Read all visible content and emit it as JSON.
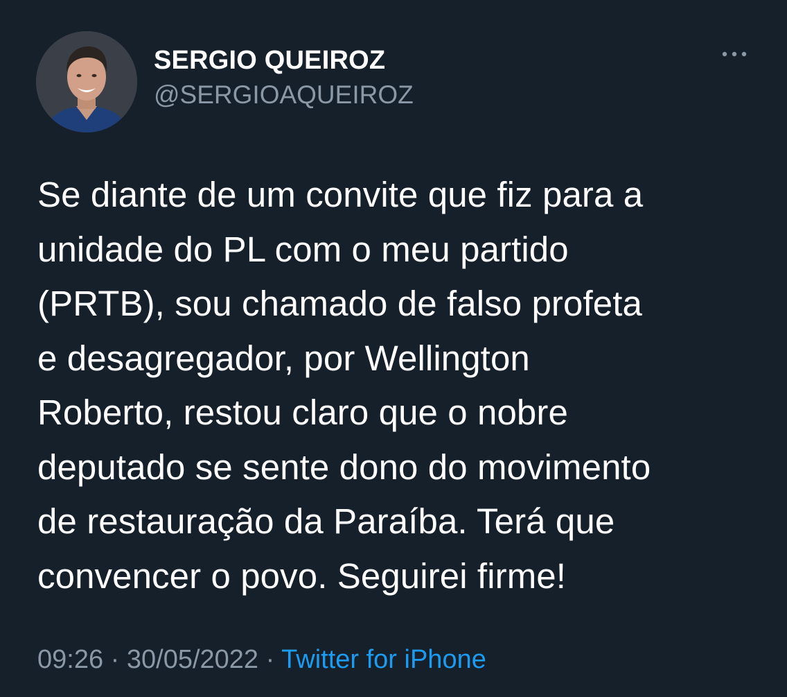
{
  "author": {
    "display_name": "SERGIO QUEIROZ",
    "handle": "@SERGIOAQUEIROZ"
  },
  "menu_icon": "more-horizontal-icon",
  "tweet": {
    "text": "Se diante de um convite que fiz para a\nunidade do PL com o meu partido\n(PRTB), sou chamado de falso profeta\ne desagregador, por Wellington\nRoberto, restou claro que o nobre\ndeputado se sente dono do movimento\nde restauração da Paraíba. Terá que\nconvencer o povo. Seguirei firme!",
    "time": "09:26",
    "separator": "·",
    "date": "30/05/2022",
    "source": "Twitter for iPhone"
  },
  "colors": {
    "background": "#15202b",
    "text": "#ffffff",
    "muted": "#8b98a5",
    "link": "#1d9bf0"
  }
}
